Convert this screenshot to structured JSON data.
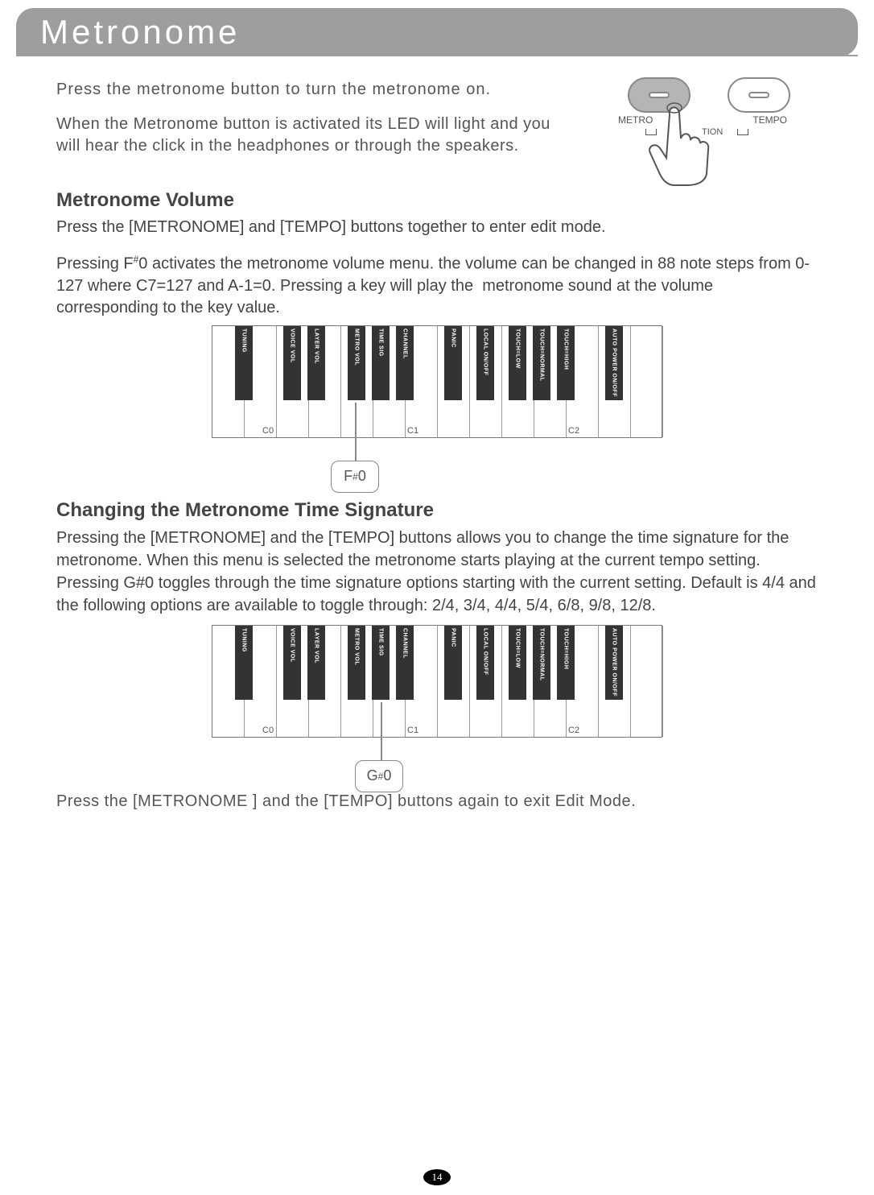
{
  "header": {
    "title": "Metronome"
  },
  "intro": {
    "line1": "Press the metronome button to turn the metronome on.",
    "line2": "When the Metronome button is activated its LED will light and you will hear the click in the headphones or through the speakers."
  },
  "buttons": {
    "left_label": "METRONOME",
    "right_label": "TEMPO",
    "sub_label": "FUNCTION"
  },
  "volume": {
    "title": "Metronome Volume",
    "p1": "Press the [METRONOME] and [TEMPO] buttons together to enter edit mode.",
    "p2": "Pressing F#0 activates the metronome volume menu. the volume can be changed in 88 note steps from 0-127 where C7=127 and A-1=0. Pressing a key will play the  metronome sound at the volume corresponding to the key value.",
    "callout": "F#0"
  },
  "timesig": {
    "title": "Changing the Metronome Time Signature",
    "p1": "Pressing the [METRONOME] and the [TEMPO] buttons allows you to change the time signature for the metronome. When this menu is selected the metronome starts playing at the current tempo setting. Pressing G#0 toggles through the time signature options starting with the current setting. Default is 4/4 and the following options are available to toggle through: 2/4, 3/4, 4/4, 5/4, 6/8, 9/8, 12/8.",
    "callout": "G#0"
  },
  "footer_text": "Press the [METRONOME ] and the [TEMPO] buttons again to exit Edit Mode.",
  "page_number": "14",
  "black_key_labels": [
    "TUNING",
    "VOICE VOL",
    "LAYER VOL",
    "METRO VOL",
    "TIME SIG",
    "CHANNEL",
    "PANIC",
    "LOCAL ON/OFF",
    "TOUCH=LOW",
    "TOUCH=NORMAL",
    "TOUCH=HIGH",
    "AUTO POWER ON/OFF"
  ],
  "white_key_labels": {
    "C0": "C0",
    "C1": "C1",
    "C2": "C2"
  }
}
